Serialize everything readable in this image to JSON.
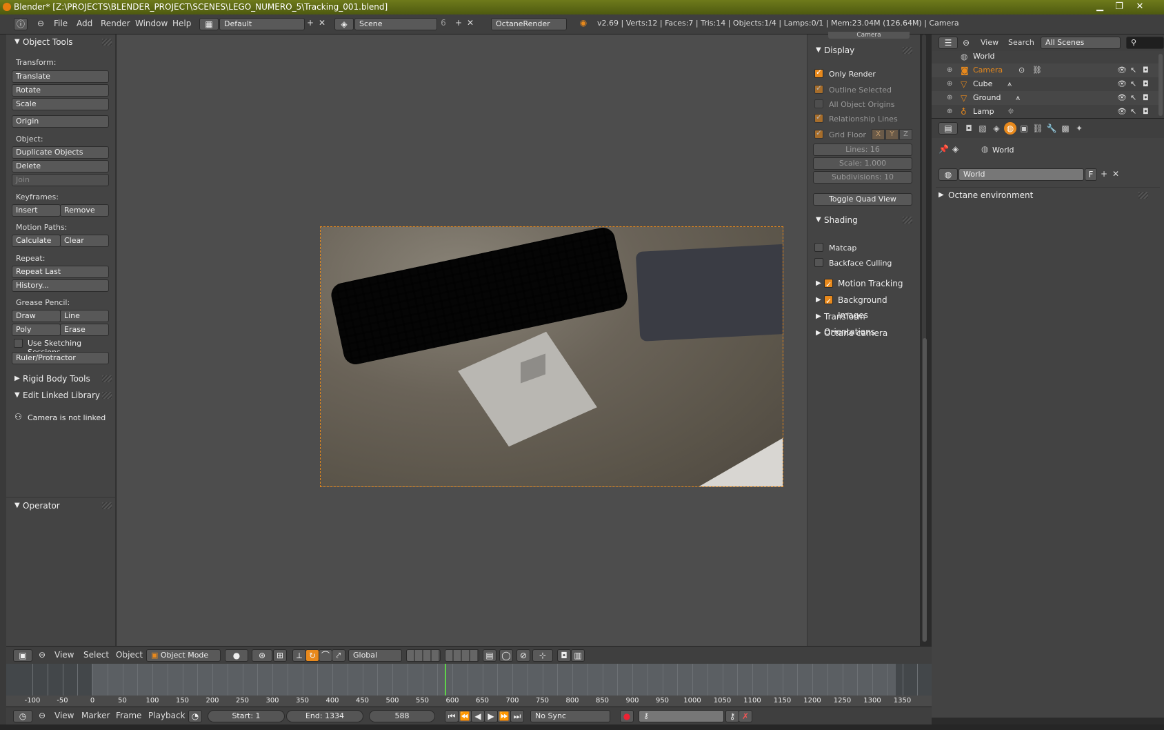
{
  "window": {
    "title": "Blender* [Z:\\PROJECTS\\BLENDER_PROJECT\\SCENES\\LEGO_NUMERO_5\\Tracking_001.blend]",
    "minimize": "▁",
    "restore": "❐",
    "close": "✕"
  },
  "infobar": {
    "menus": [
      "File",
      "Add",
      "Render",
      "Window",
      "Help"
    ],
    "screen_layout": "Default",
    "scene": "Scene",
    "scene_users": "6",
    "render_engine": "OctaneRender",
    "stats": "v2.69 | Verts:12 | Faces:7 | Tris:14 | Objects:1/4 | Lamps:0/1 | Mem:23.04M (126.64M) | Camera"
  },
  "tools": {
    "header": "Object Tools",
    "transform_label": "Transform:",
    "translate": "Translate",
    "rotate": "Rotate",
    "scale": "Scale",
    "origin": "Origin",
    "object_label": "Object:",
    "duplicate": "Duplicate Objects",
    "delete": "Delete",
    "join": "Join",
    "keyframes_label": "Keyframes:",
    "insert": "Insert",
    "remove": "Remove",
    "motion_paths_label": "Motion Paths:",
    "calculate": "Calculate",
    "clear": "Clear",
    "repeat_label": "Repeat:",
    "repeat_last": "Repeat Last",
    "history": "History...",
    "grease_label": "Grease Pencil:",
    "draw": "Draw",
    "line": "Line",
    "poly": "Poly",
    "erase": "Erase",
    "sketching": "Use Sketching Sessions",
    "ruler": "Ruler/Protractor",
    "rigid_body": "Rigid Body Tools",
    "edit_linked": "Edit Linked Library",
    "camera_not_linked": "Camera is not linked",
    "operator": "Operator"
  },
  "npanel": {
    "camera_field": "Camera",
    "display": "Display",
    "only_render": "Only Render",
    "outline_selected": "Outline Selected",
    "all_object_origins": "All Object Origins",
    "relationship_lines": "Relationship Lines",
    "grid_floor": "Grid Floor",
    "x": "X",
    "y": "Y",
    "z": "Z",
    "lines": "Lines: 16",
    "scale": "Scale: 1.000",
    "subdivisions": "Subdivisions: 10",
    "toggle_quad": "Toggle Quad View",
    "shading": "Shading",
    "matcap": "Matcap",
    "backface": "Backface Culling",
    "motion_tracking": "Motion Tracking",
    "background_images": "Background Images",
    "transform_orientations": "Transform Orientations",
    "octane_camera": "Octane camera"
  },
  "outliner": {
    "view": "View",
    "search": "Search",
    "filter": "All Scenes",
    "rows": [
      "World",
      "Camera",
      "Cube",
      "Ground",
      "Lamp"
    ]
  },
  "properties": {
    "breadcrumb": "World",
    "datablock": "World",
    "fake_user": "F",
    "panel": "Octane environment"
  },
  "view3d_header": {
    "view": "View",
    "select": "Select",
    "object": "Object",
    "mode": "Object Mode",
    "orientation": "Global"
  },
  "timeline": {
    "labels": [
      "-100",
      "-50",
      "0",
      "50",
      "100",
      "150",
      "200",
      "250",
      "300",
      "350",
      "400",
      "450",
      "500",
      "550",
      "600",
      "650",
      "700",
      "750",
      "800",
      "850",
      "900",
      "950",
      "1000",
      "1050",
      "1100",
      "1150",
      "1200",
      "1250",
      "1300",
      "1350"
    ],
    "current_frame": 588,
    "view": "View",
    "marker": "Marker",
    "frame": "Frame",
    "playback": "Playback",
    "start": "Start: 1",
    "end": "End: 1334",
    "frame_field": "588",
    "sync": "No Sync"
  },
  "colors": {
    "accent": "#e8891c",
    "frame_indicator": "#5fd34a",
    "titlebar": "#5e6a16"
  }
}
